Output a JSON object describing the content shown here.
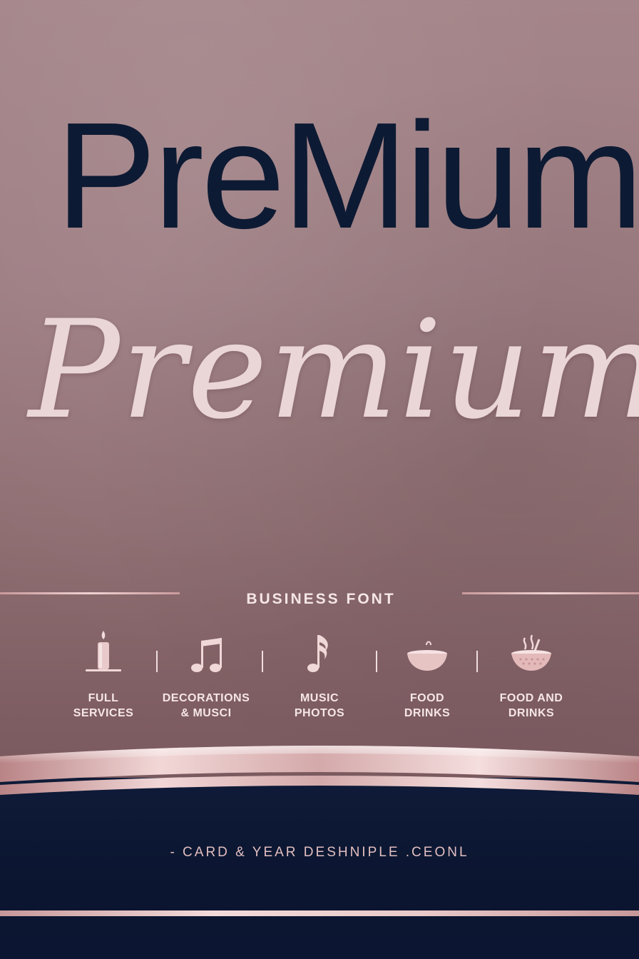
{
  "headline": {
    "sans": "PreMium",
    "script": "Premium"
  },
  "subtitle": "BUSINESS FONT",
  "services": [
    {
      "icon": "candle-icon",
      "label": "FULL\nSERVICES"
    },
    {
      "icon": "music-notes-icon",
      "label": "DECORATIONS\n& MUSCI"
    },
    {
      "icon": "music-note-icon",
      "label": "MUSIC\nPHOTOS"
    },
    {
      "icon": "bowl-icon",
      "label": "FOOD\nDRINKS"
    },
    {
      "icon": "basket-icon",
      "label": "FOOD AND\nDRINKS"
    }
  ],
  "footer": {
    "text": "- CARD & YEAR DESHNIPLE .CEONL"
  },
  "colors": {
    "navy": "#0d1a33",
    "rose": "#ead6d7",
    "rose_gold": "#e2bfc0",
    "background": "#9d7d82"
  }
}
